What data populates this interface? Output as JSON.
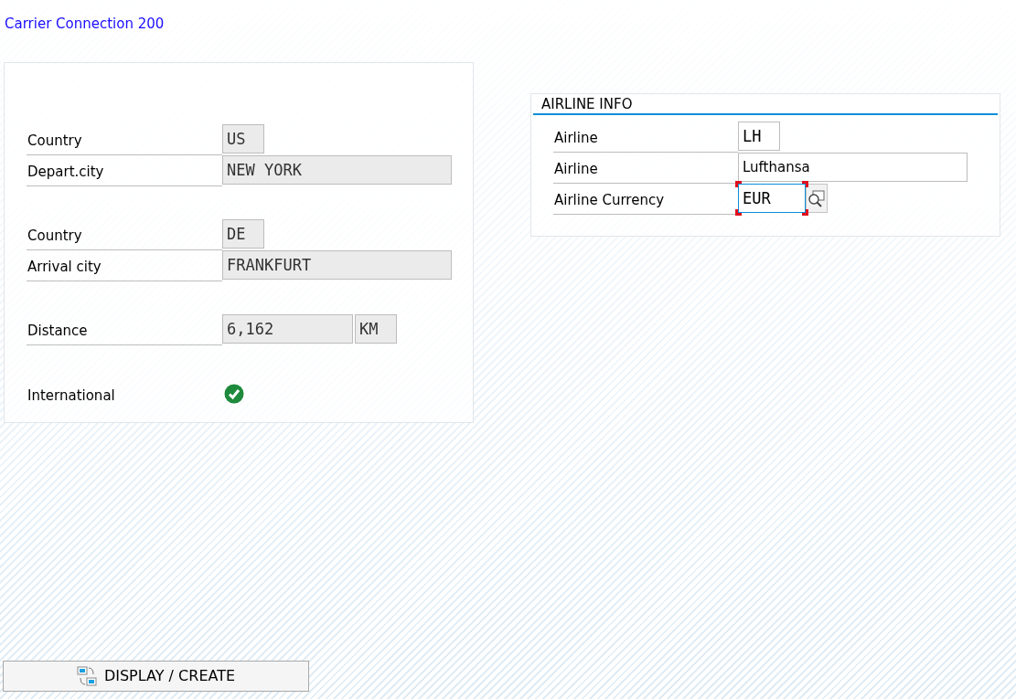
{
  "title": "Carrier Connection 200",
  "connection_panel": {
    "groups": [
      [
        {
          "label": "Country",
          "fields": [
            {
              "value": "US",
              "kind": "short",
              "disabled": true
            }
          ]
        },
        {
          "label": "Depart.city",
          "fields": [
            {
              "value": "NEW YORK",
              "kind": "long",
              "disabled": true
            }
          ]
        }
      ],
      [
        {
          "label": "Country",
          "fields": [
            {
              "value": "DE",
              "kind": "short",
              "disabled": true
            }
          ]
        },
        {
          "label": "Arrival city",
          "fields": [
            {
              "value": "FRANKFURT",
              "kind": "long",
              "disabled": true
            }
          ]
        }
      ],
      [
        {
          "label": "Distance",
          "fields": [
            {
              "value": "6,162",
              "kind": "medium",
              "disabled": true
            },
            {
              "value": "KM",
              "kind": "short",
              "disabled": true
            }
          ]
        }
      ],
      [
        {
          "label": "International",
          "checked": true
        }
      ]
    ]
  },
  "airline_panel": {
    "title": "AIRLINE INFO",
    "rows": [
      {
        "label": "Airline",
        "fields": [
          {
            "value": "LH",
            "kind": "short",
            "disabled": false
          }
        ]
      },
      {
        "label": "Airline",
        "fields": [
          {
            "value": "Lufthansa",
            "kind": "long",
            "disabled": false,
            "proportional": true
          }
        ]
      },
      {
        "label": "Airline Currency",
        "fields": [
          {
            "value": "EUR",
            "kind": "currency",
            "disabled": false,
            "focused": true,
            "value_help": true
          }
        ]
      }
    ]
  },
  "buttons": [
    {
      "label": "DISPLAY / CREATE"
    }
  ]
}
